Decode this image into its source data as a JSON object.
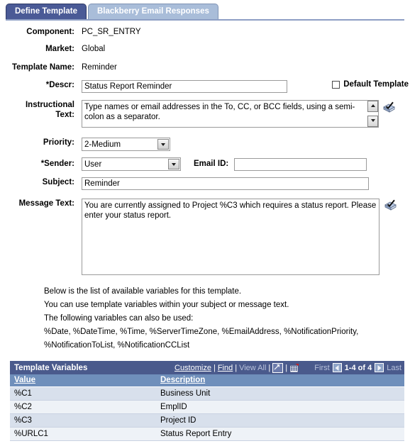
{
  "tabs": [
    {
      "label": "Define Template",
      "active": true
    },
    {
      "label": "Blackberry Email Responses",
      "active": false
    }
  ],
  "form": {
    "component": {
      "label": "Component:",
      "value": "PC_SR_ENTRY"
    },
    "market": {
      "label": "Market:",
      "value": "Global"
    },
    "template_name": {
      "label": "Template Name:",
      "value": "Reminder"
    },
    "descr": {
      "label": "*Descr:",
      "value": "Status Report Reminder"
    },
    "default_template": {
      "label": "Default Template",
      "checked": false
    },
    "instructional_text": {
      "label_line1": "Instructional",
      "label_line2": "Text:",
      "value": "Type names or email addresses in the To, CC, or BCC fields, using a semi-colon as a separator."
    },
    "priority": {
      "label": "Priority:",
      "value": "2-Medium"
    },
    "sender": {
      "label": "*Sender:",
      "value": "User"
    },
    "email_id": {
      "label": "Email ID:",
      "value": ""
    },
    "subject": {
      "label": "Subject:",
      "value": "Reminder"
    },
    "message_text": {
      "label": "Message Text:",
      "value": "You are currently assigned to Project %C3 which requires a status report. Please enter your status report."
    }
  },
  "help": {
    "line1": "Below is the list of available variables for this template.",
    "line2": "You can use template variables within your subject or message text.",
    "line3": "The following variables can also be used:",
    "line4": "%Date, %DateTime, %Time, %ServerTimeZone, %EmailAddress, %NotificationPriority,",
    "line5": "%NotificationToList, %NotificationCCList"
  },
  "grid": {
    "title": "Template Variables",
    "tools": {
      "customize": "Customize",
      "find": "Find",
      "view_all": "View All",
      "sep": "|"
    },
    "nav": {
      "first": "First",
      "count": "1-4 of 4",
      "last": "Last"
    },
    "columns": [
      "Value",
      "Description"
    ],
    "rows": [
      {
        "value": "%C1",
        "description": "Business Unit"
      },
      {
        "value": "%C2",
        "description": "EmplID"
      },
      {
        "value": "%C3",
        "description": "Project ID"
      },
      {
        "value": "%URLC1",
        "description": "Status Report Entry"
      }
    ]
  },
  "colors": {
    "tab_active": "#4a5a96",
    "tab_inactive": "#a9bdd9",
    "grid_title_bg": "#4a5a8c",
    "grid_header_bg": "#6f8fbb",
    "row_odd": "#d8e0ec",
    "row_even": "#eef2f7"
  }
}
